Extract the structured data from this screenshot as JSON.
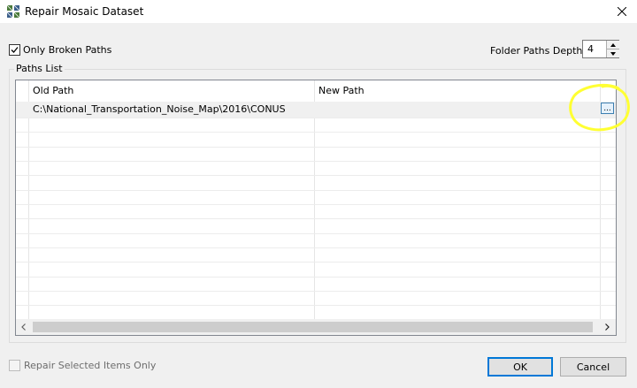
{
  "window": {
    "title": "Repair Mosaic Dataset",
    "app_icon": "mosaic-dataset-icon",
    "close_icon": "close-icon"
  },
  "options": {
    "only_broken_paths_label": "Only Broken Paths",
    "only_broken_paths_checked": true,
    "folder_paths_depth_label": "Folder Paths Depth:",
    "folder_paths_depth_value": "4"
  },
  "paths_list": {
    "group_label": "Paths List",
    "columns": [
      "Old Path",
      "New Path"
    ],
    "rows": [
      {
        "old_path": "C:\\National_Transportation_Noise_Map\\2016\\CONUS",
        "new_path": "",
        "browse_label": "..."
      }
    ]
  },
  "footer": {
    "repair_selected_label": "Repair Selected Items Only",
    "repair_selected_checked": false,
    "ok_label": "OK",
    "cancel_label": "Cancel"
  },
  "colors": {
    "highlight": "#ffff33",
    "ok_border": "#0078d7"
  }
}
